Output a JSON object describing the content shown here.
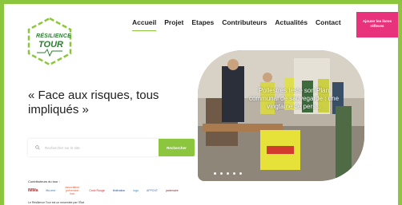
{
  "brand": {
    "line1": "RÉSILIENCE",
    "line2": "TOUR",
    "colors": {
      "green": "#8cc63f",
      "dark_green": "#2e7d32",
      "pink": "#e8327b"
    }
  },
  "nav": {
    "items": [
      {
        "label": "Accueil",
        "active": true
      },
      {
        "label": "Projet"
      },
      {
        "label": "Etapes"
      },
      {
        "label": "Contributeurs"
      },
      {
        "label": "Actualités"
      },
      {
        "label": "Contact"
      }
    ],
    "cta_label": "Ajouter les livres réflexes"
  },
  "hero": {
    "headline": "« Face aux risques, tous impliqués »",
    "search": {
      "placeholder": "Rechercher sur le site",
      "button": "Rechercher",
      "icon": "search-icon"
    },
    "photo_caption": "Pollestres teste son Plan communal de sauvegarde : une vingtaine de pers..."
  },
  "contributors": {
    "title": "Contributeurs du tour :",
    "logos": [
      "IMMa",
      "iffo-rme",
      "association prévention tout",
      "Croix Rouge",
      "fédération",
      "logo",
      "AFPCNT",
      "partenaire"
    ],
    "note": "Le Résilience Tour est un ensemble par l'État"
  },
  "carousel": {
    "count": 5,
    "active_index": 0
  }
}
